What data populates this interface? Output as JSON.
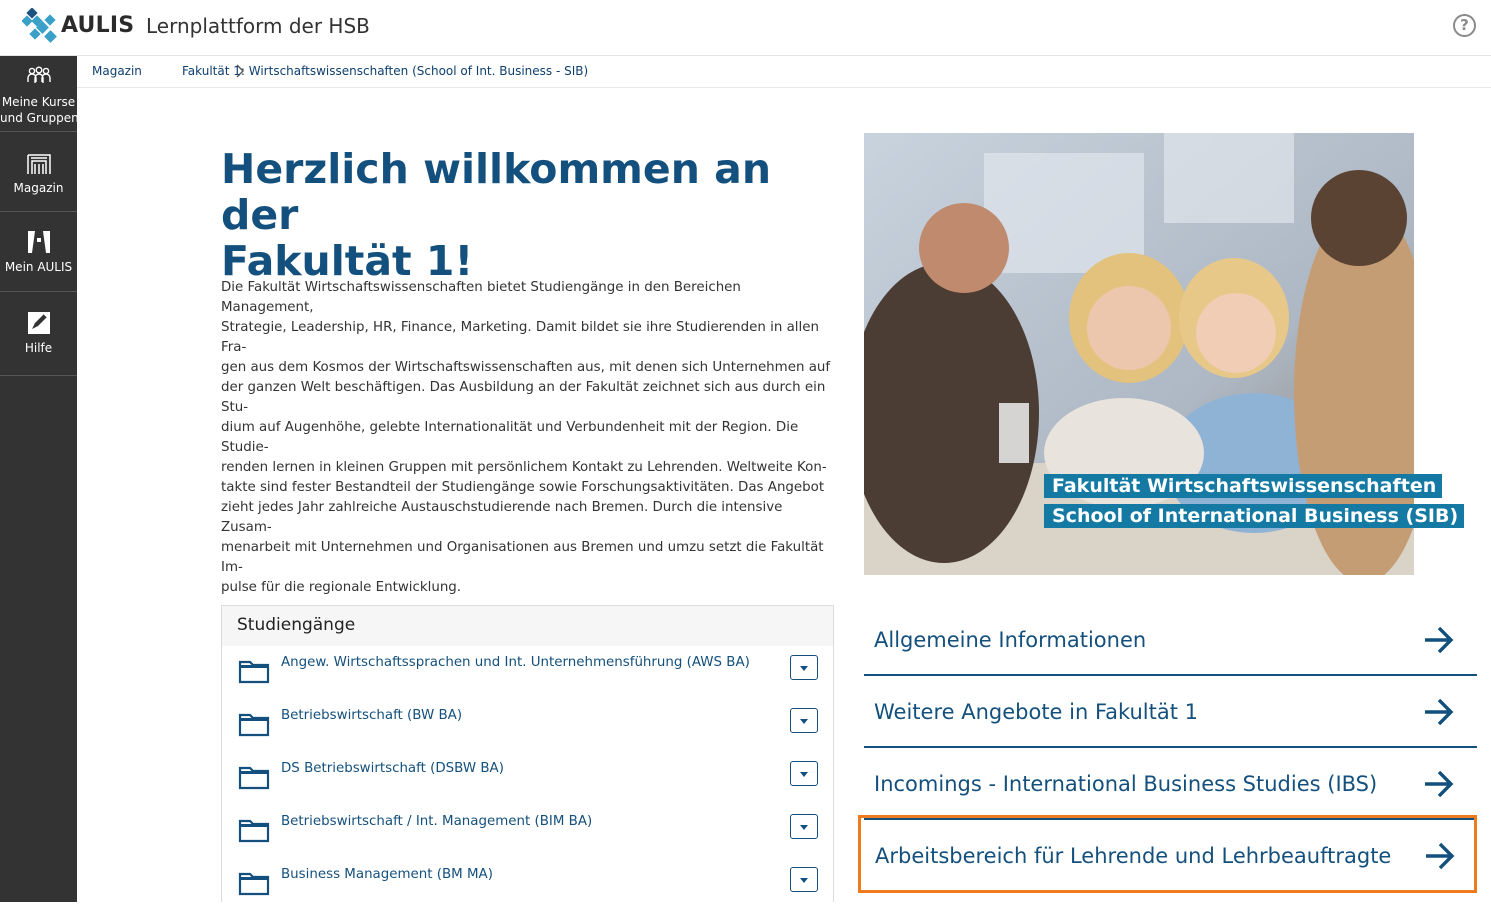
{
  "header": {
    "brand": "AULIS",
    "platform_title": "Lernplattform der HSB",
    "help_symbol": "?",
    "logo_icon": "aulis-logo-icon",
    "colors": {
      "logo_dark": "#1d5380",
      "logo_light": "#3aa0c8"
    }
  },
  "sidebar": {
    "items": [
      {
        "label_line1": "Meine Kurse",
        "label_line2": "und Gruppen",
        "icon": "people-icon"
      },
      {
        "label_line1": "Magazin",
        "label_line2": "",
        "icon": "magazine-icon"
      },
      {
        "label_line1": "Mein AULIS",
        "label_line2": "",
        "icon": "personal-desk-icon"
      },
      {
        "label_line1": "Hilfe",
        "label_line2": "",
        "icon": "help-edit-icon"
      }
    ]
  },
  "breadcrumb": {
    "items": [
      "Magazin",
      "Fakultät 1: Wirtschaftswissenschaften (School of Int. Business - SIB)"
    ]
  },
  "main": {
    "welcome_line1": "Herzlich willkommen an der",
    "welcome_line2": "Fakultät 1!",
    "intro_lines": [
      "Die Fakultät Wirtschaftswissenschaften bietet Studiengänge in den Bereichen Management,",
      "Strategie, Leadership, HR, Finance, Marketing. Damit bildet sie ihre Studierenden in allen Fra-",
      "gen aus dem Kosmos der Wirtschaftswissenschaften aus, mit denen sich Unternehmen auf",
      "der ganzen Welt beschäftigen. Das Ausbildung an der Fakultät zeichnet sich aus durch ein Stu-",
      "dium auf Augenhöhe, gelebte Internationalität und Verbundenheit mit der Region. Die Studie-",
      "renden lernen in kleinen Gruppen mit persönlichem Kontakt zu Lehrenden. Weltweite Kon-",
      "takte sind fester Bestandteil der Studiengänge sowie Forschungsaktivitäten. Das Angebot",
      "zieht jedes Jahr zahlreiche Austauschstudierende nach Bremen. Durch die intensive Zusam-",
      "menarbeit mit Unternehmen und Organisationen aus Bremen und umzu setzt die Fakultät Im-",
      "pulse für die regionale Entwicklung."
    ],
    "photo_caption_line1": "Fakultät Wirtschaftswissenschaften",
    "photo_caption_line2": "School of International Business (SIB)"
  },
  "courses": {
    "title": "Studiengänge",
    "items": [
      "Angew. Wirtschaftssprachen und Int. Unternehmensführung (AWS BA)",
      "Betriebswirtschaft (BW BA)",
      "DS Betriebswirtschaft (DSBW BA)",
      "Betriebswirtschaft / Int. Management (BIM BA)",
      "Business Management (BM MA)"
    ]
  },
  "links": [
    {
      "label": "Allgemeine Informationen",
      "highlighted": false
    },
    {
      "label": "Weitere Angebote in Fakultät 1",
      "highlighted": false
    },
    {
      "label": "Incomings - International Business Studies (IBS)",
      "highlighted": false
    },
    {
      "label": "Arbeitsbereich für Lehrende und Lehrbeauftragte",
      "highlighted": true
    }
  ],
  "colors": {
    "primary": "#14507d",
    "sidebar_bg": "#333333",
    "caption_bg": "#1479a3",
    "highlight": "#f07b1f"
  }
}
